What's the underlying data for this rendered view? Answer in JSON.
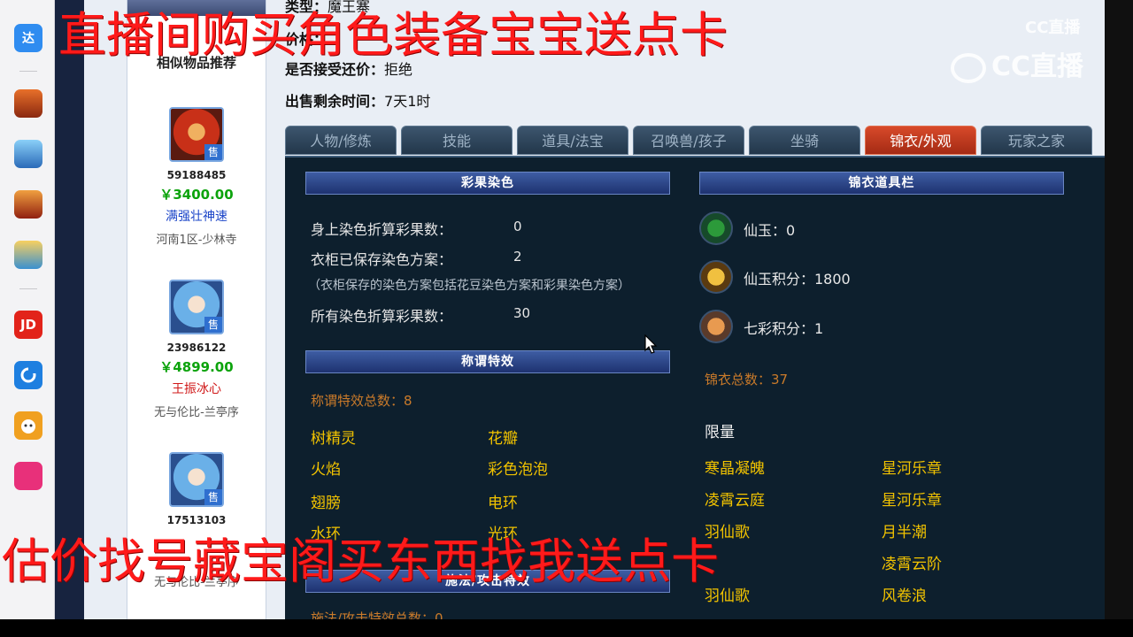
{
  "overlay": {
    "top_text": "直播间购买角色装备宝宝送点卡",
    "bottom_text": "估价找号藏宝阁买东西找我送点卡"
  },
  "watermark": {
    "small": "CC直播",
    "large": "CC直播"
  },
  "dock": {
    "items": [
      {
        "icon": "da-app-icon",
        "text": "达",
        "color": "#2f8cf0"
      },
      {
        "icon": "game1-icon",
        "text": "",
        "color": "#c8521c"
      },
      {
        "icon": "game2-icon",
        "text": "",
        "color": "#3aa0e0"
      },
      {
        "icon": "game3-icon",
        "text": "",
        "color": "#d0461a"
      },
      {
        "icon": "game4-icon",
        "text": "",
        "color": "#38a0d8"
      },
      {
        "icon": "jd-icon",
        "text": "JD",
        "color": "#e2231a"
      },
      {
        "icon": "browser-icon",
        "text": "",
        "color": "#1e7fe0"
      },
      {
        "icon": "pet-app-icon",
        "text": "",
        "color": "#f0a020"
      },
      {
        "icon": "pink-app-icon",
        "text": "",
        "color": "#e8307a"
      }
    ]
  },
  "similar": {
    "title": "相似物品推荐",
    "items": [
      {
        "id": "59188485",
        "price": "￥3400.00",
        "name": "满强壮神速",
        "name_color": "#1a44c8",
        "server": "河南1区-少林寺",
        "avatar": "red"
      },
      {
        "id": "23986122",
        "price": "￥4899.00",
        "name": "王振冰心",
        "name_color": "#d01818",
        "server": "无与伦比-兰亭序",
        "avatar": "blue"
      },
      {
        "id": "17513103",
        "price": "",
        "name": "",
        "name_color": "#1a44c8",
        "server": "无与伦比-兰亭序",
        "avatar": "blue"
      }
    ]
  },
  "info": {
    "type_label": "类型：",
    "type_value": "魔王寨",
    "price_label": "价格：",
    "bargain_label": "是否接受还价：",
    "bargain_value": "拒绝",
    "time_label": "出售剩余时间：",
    "time_value": "7天1时"
  },
  "tabs": [
    {
      "label": "人物/修炼",
      "active": false
    },
    {
      "label": "技能",
      "active": false
    },
    {
      "label": "道具/法宝",
      "active": false
    },
    {
      "label": "召唤兽/孩子",
      "active": false
    },
    {
      "label": "坐骑",
      "active": false
    },
    {
      "label": "锦衣/外观",
      "active": true
    },
    {
      "label": "玩家之家",
      "active": false
    }
  ],
  "dye": {
    "title": "彩果染色",
    "rows": [
      {
        "label": "身上染色折算彩果数：",
        "value": "0"
      },
      {
        "label": "衣柜已保存染色方案：",
        "value": "2"
      }
    ],
    "note": "（衣柜保存的染色方案包括花豆染色方案和彩果染色方案）",
    "total_label": "所有染色折算彩果数：",
    "total_value": "30"
  },
  "titles": {
    "title": "称谓特效",
    "count_label": "称谓特效总数：8",
    "items": [
      "树精灵",
      "花瓣",
      "火焰",
      "彩色泡泡",
      "翅膀",
      "电环",
      "水环",
      "光环"
    ]
  },
  "next_section": {
    "title": "施法/攻击特效",
    "count_label": "施法/攻击特效总数：0"
  },
  "jinyi": {
    "title": "锦衣道具栏",
    "props": [
      {
        "icon": "jade-icon",
        "label": "仙玉：0"
      },
      {
        "icon": "jade-points-icon",
        "label": "仙玉积分：1800"
      },
      {
        "icon": "rainbow-points-icon",
        "label": "七彩积分：1"
      }
    ],
    "total_label": "锦衣总数：37",
    "limited_label": "限量",
    "items": [
      "寒晶凝魄",
      "星河乐章",
      "凌霄云庭",
      "星河乐章",
      "羽仙歌",
      "月半潮",
      "",
      "凌霄云阶",
      "羽仙歌",
      "风卷浪",
      "",
      ""
    ]
  }
}
